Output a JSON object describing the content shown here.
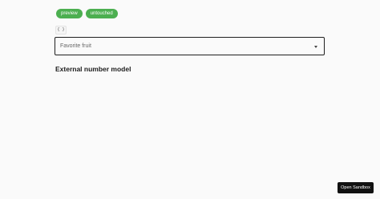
{
  "badges": {
    "preview_label": "preview",
    "untouched_label": "untouched"
  },
  "code_toggle": {
    "glyph": "{ }"
  },
  "select": {
    "label": "Favorite fruit",
    "arrow_icon": "chevron-down-icon"
  },
  "section": {
    "heading": "External number model"
  },
  "sandbox": {
    "button_label": "Open Sandbox"
  },
  "colors": {
    "badge_green": "#4caf50",
    "button_dark": "#111111",
    "field_border": "#1f1f1f"
  }
}
